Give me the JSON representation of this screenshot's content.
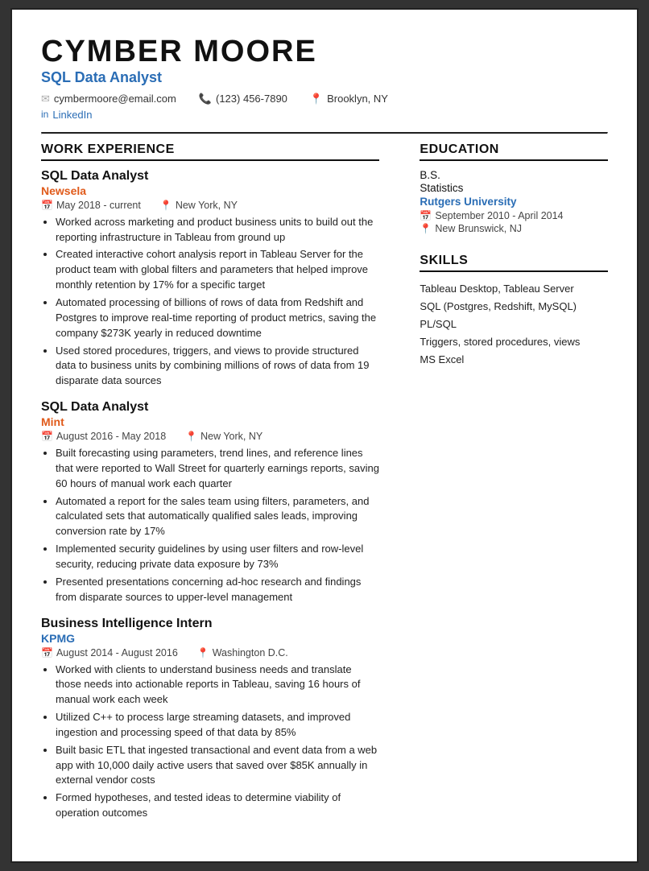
{
  "header": {
    "name": "CYMBER  MOORE",
    "title": "SQL Data Analyst",
    "email": "cymbermoore@email.com",
    "phone": "(123) 456-7890",
    "location": "Brooklyn, NY",
    "linkedin_label": "LinkedIn"
  },
  "sections": {
    "work_experience_title": "WORK EXPERIENCE",
    "education_title": "EDUCATION",
    "skills_title": "SKILLS"
  },
  "work_experience": [
    {
      "job_title": "SQL Data Analyst",
      "company": "Newsela",
      "company_color": "orange",
      "date_range": "May 2018 - current",
      "location": "New York, NY",
      "bullets": [
        "Worked across marketing and product business units to build out the reporting infrastructure in Tableau from ground up",
        "Created interactive cohort analysis report in Tableau Server for the product team with global filters and parameters that helped improve monthly retention by 17% for a specific target",
        "Automated processing of billions of rows of data from Redshift and Postgres to improve real-time reporting of product metrics, saving the company $273K yearly in reduced downtime",
        "Used stored procedures, triggers, and views to provide structured data to business units by combining millions of rows of data from 19 disparate data sources"
      ]
    },
    {
      "job_title": "SQL Data Analyst",
      "company": "Mint",
      "company_color": "orange",
      "date_range": "August 2016 - May 2018",
      "location": "New York, NY",
      "bullets": [
        "Built forecasting using parameters, trend lines, and reference lines that were reported to Wall Street for quarterly earnings reports, saving 60 hours of manual work each quarter",
        "Automated a report for the sales team using filters, parameters, and calculated sets that automatically qualified sales leads, improving conversion rate by 17%",
        "Implemented security guidelines by using user filters and row-level security, reducing private data exposure by 73%",
        "Presented presentations concerning ad-hoc research and findings from disparate sources to upper-level management"
      ]
    },
    {
      "job_title": "Business Intelligence Intern",
      "company": "KPMG",
      "company_color": "blue",
      "date_range": "August 2014 - August 2016",
      "location": "Washington D.C.",
      "bullets": [
        "Worked with clients to understand business needs and translate those needs into actionable reports in Tableau, saving 16 hours of manual work each week",
        "Utilized C++ to process large streaming datasets, and improved ingestion and processing speed of that data by 85%",
        "Built basic ETL that ingested transactional and event data from a web app with 10,000 daily active users that saved over $85K annually in external vendor costs",
        "Formed hypotheses, and tested ideas to determine viability of operation outcomes"
      ]
    }
  ],
  "education": {
    "degree": "B.S.",
    "field": "Statistics",
    "school": "Rutgers University",
    "dates": "September 2010 - April 2014",
    "location": "New Brunswick, NJ"
  },
  "skills": {
    "items": [
      "Tableau Desktop, Tableau Server",
      "SQL (Postgres, Redshift, MySQL)",
      "PL/SQL",
      "Triggers, stored procedures, views",
      "MS Excel"
    ]
  }
}
